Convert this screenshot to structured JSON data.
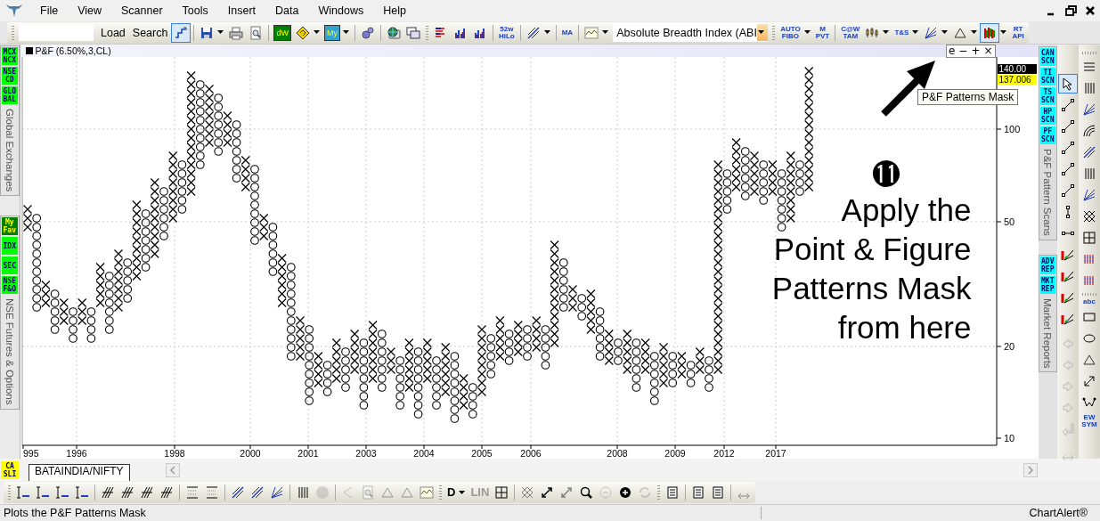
{
  "menu": {
    "items": [
      "File",
      "View",
      "Scanner",
      "Tools",
      "Insert",
      "Data",
      "Windows",
      "Help"
    ]
  },
  "top_toolbar": [
    {
      "kind": "grip"
    },
    {
      "kind": "field"
    },
    {
      "kind": "button",
      "label": "Load"
    },
    {
      "kind": "button",
      "label": "Search"
    },
    {
      "kind": "icon",
      "selected": true
    },
    {
      "kind": "separator"
    },
    {
      "kind": "icon",
      "selected": false,
      "dropdown": true
    },
    {
      "kind": "icon",
      "selected": false
    },
    {
      "kind": "icon",
      "selected": false
    },
    {
      "kind": "separator"
    },
    {
      "kind": "boxbadge",
      "label": "dW",
      "color": "#008000"
    },
    {
      "kind": "icon",
      "selected": false,
      "dropdown": true
    },
    {
      "kind": "boxbadge",
      "label": "My",
      "color": "#33a0d0",
      "dropdown": true
    },
    {
      "kind": "separator"
    },
    {
      "kind": "icon",
      "selected": false
    },
    {
      "kind": "separator"
    },
    {
      "kind": "icon",
      "selected": false
    },
    {
      "kind": "icon",
      "selected": false
    },
    {
      "kind": "grip"
    },
    {
      "kind": "icon",
      "selected": false
    },
    {
      "kind": "icon",
      "selected": false
    },
    {
      "kind": "icon",
      "selected": false
    },
    {
      "kind": "separator"
    },
    {
      "kind": "badge",
      "label": "52w\nHiLo"
    },
    {
      "kind": "separator"
    },
    {
      "kind": "icon",
      "selected": false,
      "dropdown": true
    },
    {
      "kind": "separator"
    },
    {
      "kind": "badge",
      "label": "MA"
    },
    {
      "kind": "separator"
    },
    {
      "kind": "icon",
      "selected": false,
      "dropdown": true
    },
    {
      "kind": "combo",
      "label": "Absolute Breadth Index (ABI"
    },
    {
      "kind": "grip"
    },
    {
      "kind": "badge",
      "label": "AUTO\nFIBO",
      "dropdown": true
    },
    {
      "kind": "badge",
      "label": "M\nPVT"
    },
    {
      "kind": "separator"
    },
    {
      "kind": "badge",
      "label": "C@W\nTAM"
    },
    {
      "kind": "icon",
      "selected": false,
      "dropdown": true
    },
    {
      "kind": "badge",
      "label": "T&S",
      "dropdown": true
    },
    {
      "kind": "icon",
      "selected": false,
      "dropdown": true
    },
    {
      "kind": "icon",
      "selected": false,
      "dropdown": true
    },
    {
      "kind": "icon",
      "selected": true,
      "dropdown": true
    },
    {
      "kind": "badge",
      "label": "RT\nAPI"
    }
  ],
  "left_rail": [
    {
      "badges": [
        {
          "label": "MCX\nNCX",
          "color": "#00ff00"
        },
        {
          "label": "NSE\nCD",
          "color": "#00ff00"
        },
        {
          "label": "GLO\nBAL",
          "color": "#00ff00"
        }
      ],
      "caption": "Global Exchanges"
    },
    {
      "badges": [
        {
          "label": "My\nFav",
          "color": "#008000"
        },
        {
          "label": "IDX",
          "color": "#00ff00"
        },
        {
          "label": "SEC",
          "color": "#00ff00"
        },
        {
          "label": "NSE\nF&O",
          "color": "#00ff00"
        }
      ],
      "caption": "NSE Futures & Options"
    }
  ],
  "chart": {
    "title": "P&F (6.50%,3,CL)",
    "controls": [
      "e",
      "−",
      "+",
      "×"
    ],
    "price_labels": [
      {
        "text": "140.00",
        "kind": "last"
      },
      {
        "text": "137.006",
        "kind": "current"
      }
    ],
    "y_axis_labels": [
      "100",
      "50",
      "20",
      "10"
    ],
    "x_axis_labels": [
      "995",
      "1996",
      "1998",
      "2000",
      "2001",
      "2003",
      "2004",
      "2005",
      "2006",
      "2008",
      "2009",
      "2012",
      "2017"
    ],
    "annotation": {
      "number": "⓫",
      "text": "Apply the\nPoint & Figure\nPatterns Mask\nfrom here"
    }
  },
  "tooltip": "P&F Patterns Mask",
  "scan_rail": [
    {
      "badges": [
        {
          "label": "CAN\nSCN",
          "color": "#00ffff"
        },
        {
          "label": "TI\nSCN",
          "color": "#00ffff"
        },
        {
          "label": "TS\nSCN",
          "color": "#00ffff"
        },
        {
          "label": "HP\nSCN",
          "color": "#00ffff"
        },
        {
          "label": "PF\nSCN",
          "color": "#00ffff"
        }
      ],
      "caption": "P&F Pattern Scans"
    },
    {
      "badges": [
        {
          "label": "ADV\nREP",
          "color": "#00ffff"
        },
        {
          "label": "MKT\nREP",
          "color": "#00ffff"
        }
      ],
      "caption": "Market Reports"
    }
  ],
  "draw_tools_left": [
    {
      "kind": "icon",
      "selected": true,
      "disabled": false
    },
    {
      "kind": "icon",
      "selected": false,
      "disabled": false
    },
    {
      "kind": "icon",
      "selected": false,
      "disabled": false
    },
    {
      "kind": "icon",
      "selected": false,
      "disabled": false
    },
    {
      "kind": "icon",
      "selected": false,
      "disabled": false
    },
    {
      "kind": "icon",
      "selected": false,
      "disabled": false
    },
    {
      "kind": "icon",
      "selected": false,
      "disabled": false
    },
    {
      "kind": "icon",
      "selected": false,
      "disabled": false
    },
    {
      "kind": "icon",
      "selected": false,
      "disabled": false
    },
    {
      "kind": "icon",
      "selected": false,
      "disabled": false
    },
    {
      "kind": "icon",
      "selected": false,
      "disabled": false
    },
    {
      "kind": "icon",
      "selected": false,
      "disabled": false
    },
    {
      "kind": "grip"
    },
    {
      "kind": "icon",
      "selected": false,
      "disabled": true
    },
    {
      "kind": "icon",
      "selected": false,
      "disabled": true
    },
    {
      "kind": "icon",
      "selected": false,
      "disabled": true
    },
    {
      "kind": "icon",
      "selected": false,
      "disabled": true
    },
    {
      "kind": "icon",
      "selected": false,
      "disabled": true
    },
    {
      "kind": "grip"
    },
    {
      "kind": "icon",
      "selected": false,
      "disabled": true
    }
  ],
  "draw_tools_right": [
    {
      "kind": "grip"
    },
    {
      "kind": "icon",
      "selected": false,
      "disabled": false
    },
    {
      "kind": "icon",
      "selected": false,
      "disabled": false
    },
    {
      "kind": "icon",
      "selected": false,
      "disabled": false
    },
    {
      "kind": "icon",
      "selected": false,
      "disabled": false
    },
    {
      "kind": "icon",
      "selected": false,
      "disabled": false
    },
    {
      "kind": "icon",
      "selected": false,
      "disabled": false
    },
    {
      "kind": "icon",
      "selected": false,
      "disabled": false
    },
    {
      "kind": "icon",
      "selected": false,
      "disabled": false
    },
    {
      "kind": "icon",
      "selected": false,
      "disabled": false
    },
    {
      "kind": "icon",
      "selected": false,
      "disabled": false
    },
    {
      "kind": "icon",
      "selected": false,
      "disabled": false
    },
    {
      "kind": "grip"
    },
    {
      "kind": "badge",
      "label": "abc"
    },
    {
      "kind": "icon",
      "selected": false,
      "disabled": false
    },
    {
      "kind": "icon",
      "selected": false,
      "disabled": false
    },
    {
      "kind": "icon",
      "selected": false,
      "disabled": false
    },
    {
      "kind": "icon",
      "selected": false,
      "disabled": false
    },
    {
      "kind": "icon",
      "selected": false,
      "disabled": false
    },
    {
      "kind": "badge",
      "label": "EW\nSYM"
    }
  ],
  "tab_strip": {
    "badge": {
      "label": "CA\nSLI",
      "color": "#ffff00"
    },
    "tabs": [
      {
        "label": "BATAINDIA/NIFTY",
        "selected": true
      }
    ]
  },
  "bottom_toolbar": [
    {
      "kind": "grip"
    },
    {
      "kind": "icon",
      "disabled": false
    },
    {
      "kind": "icon",
      "disabled": false
    },
    {
      "kind": "icon",
      "disabled": false
    },
    {
      "kind": "icon",
      "disabled": false
    },
    {
      "kind": "separator"
    },
    {
      "kind": "icon",
      "disabled": false
    },
    {
      "kind": "icon",
      "disabled": false
    },
    {
      "kind": "icon",
      "disabled": false
    },
    {
      "kind": "icon",
      "disabled": false
    },
    {
      "kind": "separator"
    },
    {
      "kind": "icon",
      "disabled": false
    },
    {
      "kind": "icon",
      "disabled": false
    },
    {
      "kind": "separator"
    },
    {
      "kind": "icon",
      "disabled": false
    },
    {
      "kind": "icon",
      "disabled": false
    },
    {
      "kind": "icon",
      "disabled": false
    },
    {
      "kind": "separator"
    },
    {
      "kind": "icon",
      "disabled": false
    },
    {
      "kind": "icon",
      "disabled": true
    },
    {
      "kind": "separator"
    },
    {
      "kind": "icon",
      "disabled": true
    },
    {
      "kind": "icon",
      "disabled": true
    },
    {
      "kind": "icon",
      "disabled": true
    },
    {
      "kind": "icon",
      "disabled": true
    },
    {
      "kind": "icon",
      "disabled": false
    },
    {
      "kind": "grip"
    },
    {
      "kind": "badge",
      "label": "D",
      "dropdown": true,
      "disabled": false
    },
    {
      "kind": "badge",
      "label": "LIN",
      "disabled": true
    },
    {
      "kind": "icon",
      "disabled": false
    },
    {
      "kind": "separator"
    },
    {
      "kind": "icon",
      "disabled": true
    },
    {
      "kind": "icon",
      "disabled": false
    },
    {
      "kind": "icon",
      "disabled": true
    },
    {
      "kind": "icon",
      "disabled": false
    },
    {
      "kind": "icon",
      "disabled": true
    },
    {
      "kind": "icon",
      "disabled": false
    },
    {
      "kind": "icon",
      "disabled": true
    },
    {
      "kind": "grip"
    },
    {
      "kind": "icon",
      "disabled": false
    },
    {
      "kind": "separator"
    },
    {
      "kind": "icon",
      "disabled": false
    },
    {
      "kind": "icon",
      "disabled": false
    },
    {
      "kind": "separator"
    },
    {
      "kind": "icon",
      "disabled": false
    }
  ],
  "status_bar": {
    "message": "Plots the P&F Patterns Mask",
    "product": "ChartAlert®"
  }
}
